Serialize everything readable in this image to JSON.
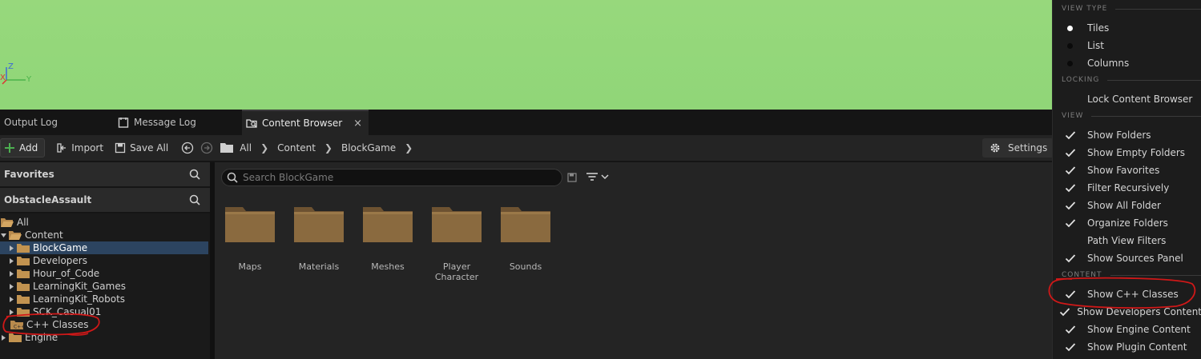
{
  "viewport": {
    "axis_labels": {
      "z": "Z",
      "x": "X",
      "y": "Y"
    }
  },
  "tabs": [
    {
      "label": "Output Log"
    },
    {
      "label": "Message Log"
    },
    {
      "label": "Content Browser",
      "close": "×"
    }
  ],
  "toolbar": {
    "add_label": "Add",
    "import_label": "Import",
    "save_all_label": "Save All",
    "breadcrumb": [
      "All",
      "Content",
      "BlockGame"
    ],
    "settings_label": "Settings"
  },
  "left_panel": {
    "favorites_label": "Favorites",
    "project_label": "ObstacleAssault",
    "tree": [
      {
        "label": "All"
      },
      {
        "label": "Content"
      },
      {
        "label": "BlockGame"
      },
      {
        "label": "Developers"
      },
      {
        "label": "Hour_of_Code"
      },
      {
        "label": "LearningKit_Games"
      },
      {
        "label": "LearningKit_Robots"
      },
      {
        "label": "SCK_Casual01"
      },
      {
        "label": "C++ Classes"
      },
      {
        "label": "Engine"
      }
    ]
  },
  "content": {
    "search_placeholder": "Search BlockGame",
    "folders": [
      {
        "label": "Maps"
      },
      {
        "label": "Materials"
      },
      {
        "label": "Meshes"
      },
      {
        "label": "Player Character"
      },
      {
        "label": "Sounds"
      }
    ]
  },
  "settings_menu": {
    "sections": {
      "view_type": "VIEW TYPE",
      "locking": "LOCKING",
      "view": "VIEW",
      "content": "CONTENT"
    },
    "view_type_items": [
      {
        "label": "Tiles",
        "selected": true
      },
      {
        "label": "List",
        "selected": false
      },
      {
        "label": "Columns",
        "selected": false
      }
    ],
    "locking_items": [
      {
        "label": "Lock Content Browser"
      }
    ],
    "view_items": [
      {
        "label": "Show Folders",
        "checked": true
      },
      {
        "label": "Show Empty Folders",
        "checked": true
      },
      {
        "label": "Show Favorites",
        "checked": true
      },
      {
        "label": "Filter Recursively",
        "checked": true
      },
      {
        "label": "Show All Folder",
        "checked": true
      },
      {
        "label": "Organize Folders",
        "checked": true
      },
      {
        "label": "Path View Filters",
        "checked": false
      },
      {
        "label": "Show Sources Panel",
        "checked": true
      }
    ],
    "content_items": [
      {
        "label": "Show C++ Classes",
        "checked": true
      },
      {
        "label": "Show Developers Content",
        "checked": true
      },
      {
        "label": "Show Engine Content",
        "checked": true
      },
      {
        "label": "Show Plugin Content",
        "checked": true
      }
    ]
  },
  "colors": {
    "viewport_green": "#93d77a",
    "folder_brown": "#8a6a3f",
    "selection_blue": "#2c4460",
    "annotation_red": "#d01818"
  }
}
